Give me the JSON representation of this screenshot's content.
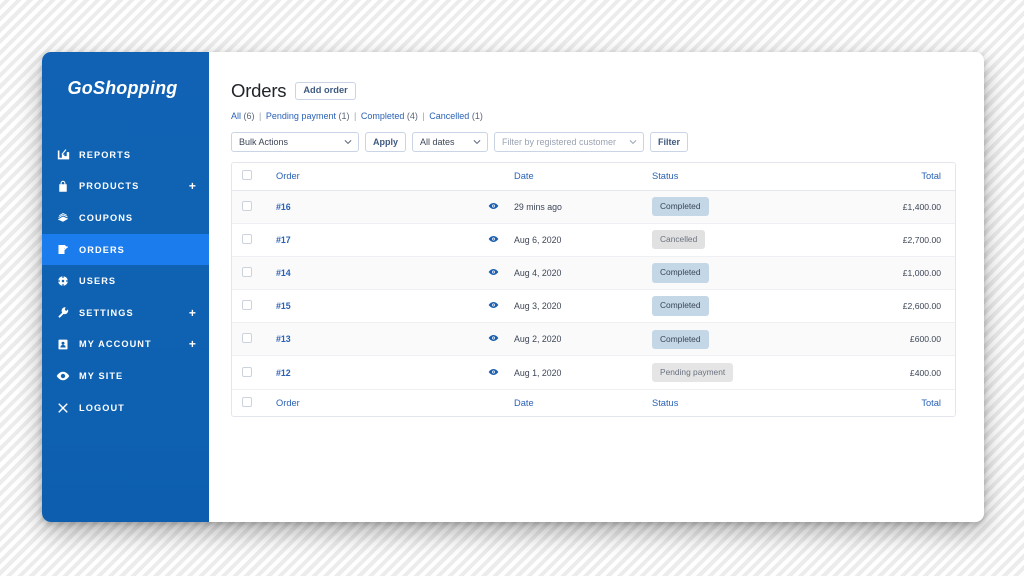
{
  "brand": {
    "name": "GoShopping",
    "sidebar_color": "#0f62b2",
    "active_color": "#1b7ced"
  },
  "sidebar": {
    "items": [
      {
        "label": "REPORTS",
        "icon": "bar-chart-icon",
        "expandable": false,
        "active": false
      },
      {
        "label": "PRODUCTS",
        "icon": "bag-icon",
        "expandable": true,
        "active": false,
        "plus": "+"
      },
      {
        "label": "COUPONS",
        "icon": "coupon-icon",
        "expandable": false,
        "active": false
      },
      {
        "label": "ORDERS",
        "icon": "orders-icon",
        "expandable": false,
        "active": true
      },
      {
        "label": "USERS",
        "icon": "users-icon",
        "expandable": false,
        "active": false
      },
      {
        "label": "SETTINGS",
        "icon": "wrench-icon",
        "expandable": true,
        "active": false,
        "plus": "+"
      },
      {
        "label": "MY ACCOUNT",
        "icon": "account-icon",
        "expandable": true,
        "active": false,
        "plus": "+"
      },
      {
        "label": "MY SITE",
        "icon": "eye-icon",
        "expandable": false,
        "active": false
      },
      {
        "label": "LOGOUT",
        "icon": "close-icon",
        "expandable": false,
        "active": false
      }
    ]
  },
  "page": {
    "title": "Orders",
    "add_button": "Add order",
    "filters": [
      {
        "label": "All",
        "count": "(6)"
      },
      {
        "label": "Pending payment",
        "count": "(1)"
      },
      {
        "label": "Completed",
        "count": "(4)"
      },
      {
        "label": "Cancelled",
        "count": "(1)"
      }
    ],
    "separator": "|"
  },
  "toolbar": {
    "bulk_actions_value": "Bulk Actions",
    "apply_label": "Apply",
    "dates_value": "All dates",
    "customer_placeholder": "Filter by registered customer",
    "filter_label": "Filter"
  },
  "table": {
    "columns": [
      "Order",
      "Date",
      "Status",
      "Total"
    ],
    "rows": [
      {
        "order": "#16",
        "date": "29 mins ago",
        "status": "Completed",
        "status_type": "completed",
        "total": "£1,400.00"
      },
      {
        "order": "#17",
        "date": "Aug 6, 2020",
        "status": "Cancelled",
        "status_type": "cancelled",
        "total": "£2,700.00"
      },
      {
        "order": "#14",
        "date": "Aug 4, 2020",
        "status": "Completed",
        "status_type": "completed",
        "total": "£1,000.00"
      },
      {
        "order": "#15",
        "date": "Aug 3, 2020",
        "status": "Completed",
        "status_type": "completed",
        "total": "£2,600.00"
      },
      {
        "order": "#13",
        "date": "Aug 2, 2020",
        "status": "Completed",
        "status_type": "completed",
        "total": "£600.00"
      },
      {
        "order": "#12",
        "date": "Aug 1, 2020",
        "status": "Pending payment",
        "status_type": "pending",
        "total": "£400.00"
      }
    ]
  }
}
